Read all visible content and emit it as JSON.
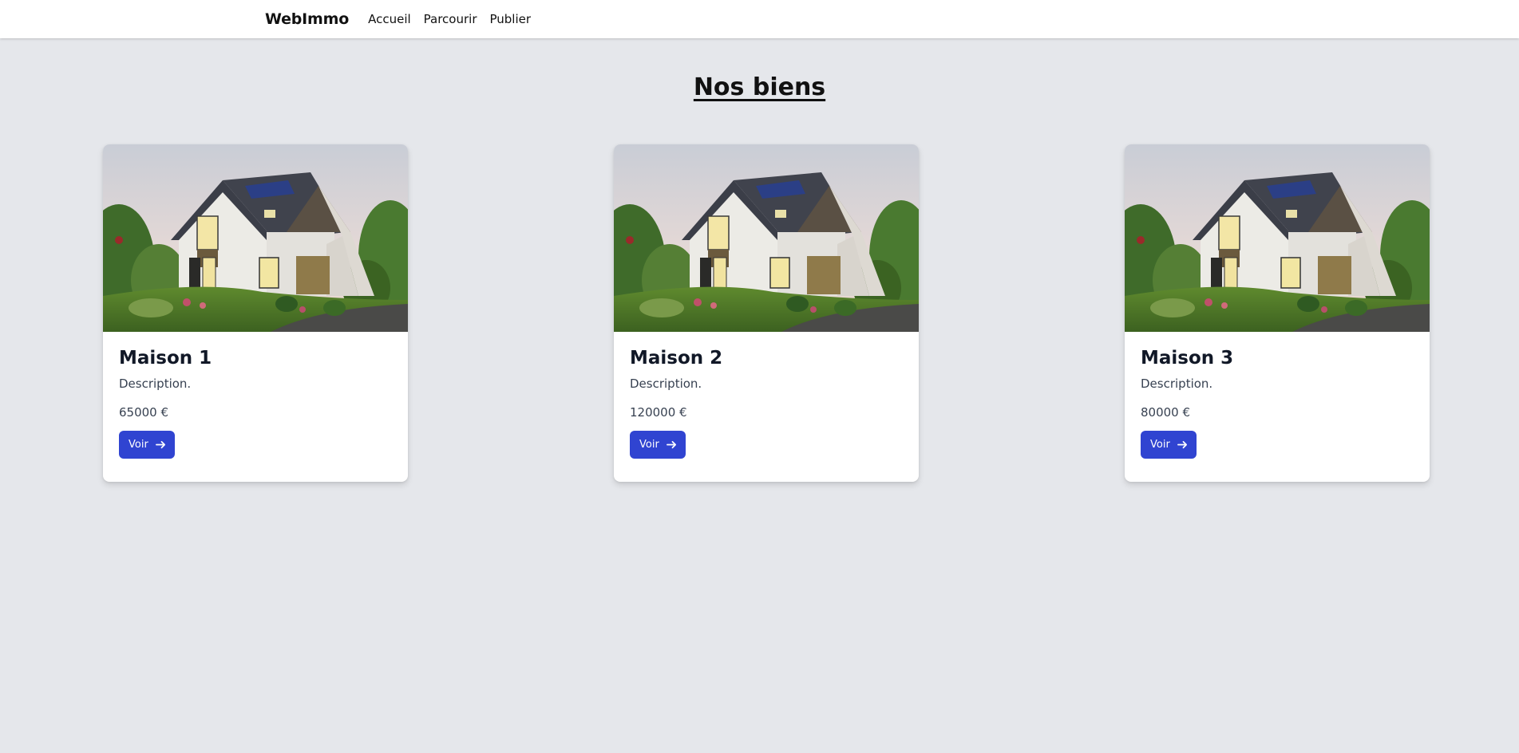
{
  "nav": {
    "brand": "WebImmo",
    "links": [
      "Accueil",
      "Parcourir",
      "Publier"
    ]
  },
  "page": {
    "title": "Nos biens"
  },
  "listings": [
    {
      "title": "Maison 1",
      "description": "Description.",
      "price": "65000 €",
      "button_label": "Voir"
    },
    {
      "title": "Maison 2",
      "description": "Description.",
      "price": "120000 €",
      "button_label": "Voir"
    },
    {
      "title": "Maison 3",
      "description": "Description.",
      "price": "80000 €",
      "button_label": "Voir"
    }
  ],
  "colors": {
    "background": "#e5e7eb",
    "button": "#3044d1",
    "card": "#ffffff"
  },
  "icons": {
    "button_icon": "arrow-right-icon"
  }
}
